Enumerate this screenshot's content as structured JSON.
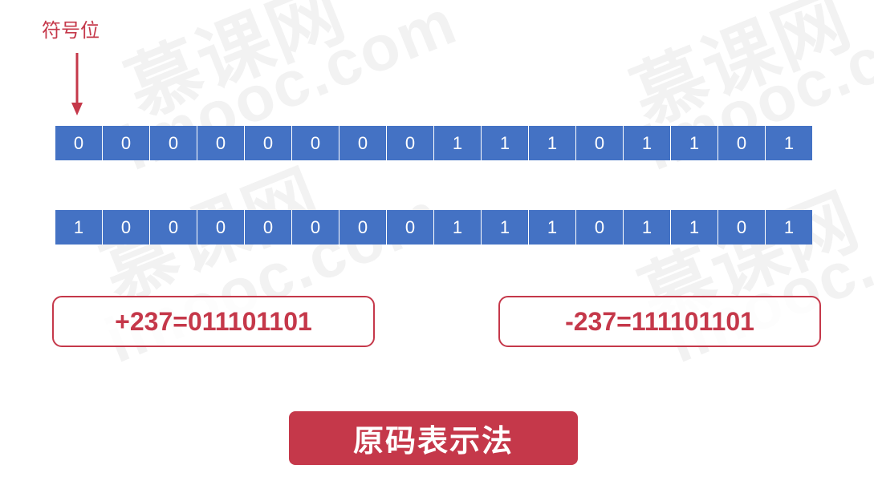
{
  "watermark": {
    "brand_cn": "慕课网",
    "brand_en": "imooc.com"
  },
  "sign_label": "符号位",
  "arrow_icon": "down-arrow-icon",
  "rows": [
    {
      "bits": [
        "0",
        "0",
        "0",
        "0",
        "0",
        "0",
        "0",
        "0",
        "1",
        "1",
        "1",
        "0",
        "1",
        "1",
        "0",
        "1"
      ]
    },
    {
      "bits": [
        "1",
        "0",
        "0",
        "0",
        "0",
        "0",
        "0",
        "0",
        "1",
        "1",
        "1",
        "0",
        "1",
        "1",
        "0",
        "1"
      ]
    }
  ],
  "equations": {
    "positive": "+237=011101101",
    "negative": "-237=111101101"
  },
  "title": "原码表示法",
  "colors": {
    "bit_fill": "#4472c4",
    "accent": "#c5384a",
    "text_on_fill": "#ffffff"
  }
}
